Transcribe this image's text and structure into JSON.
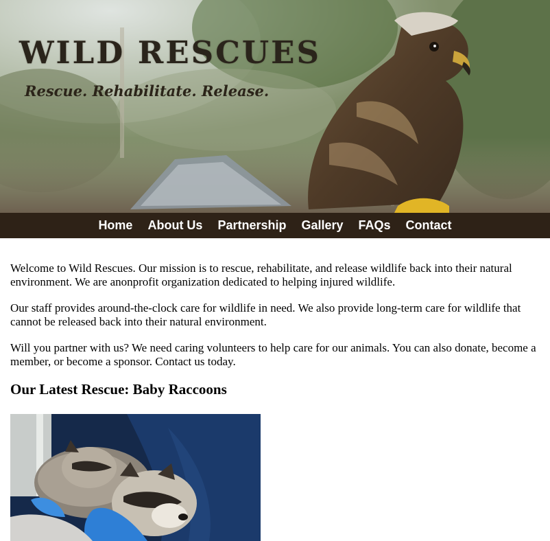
{
  "site": {
    "title": "WILD RESCUES",
    "tagline": "Rescue. Rehabilitate. Release."
  },
  "nav": {
    "items": [
      {
        "label": "Home"
      },
      {
        "label": "About Us"
      },
      {
        "label": "Partnership"
      },
      {
        "label": "Gallery"
      },
      {
        "label": "FAQs"
      },
      {
        "label": "Contact"
      }
    ]
  },
  "main": {
    "paragraphs": [
      "Welcome to Wild Rescues. Our mission is to rescue, rehabilitate, and release wildlife back into their natural environment. We are anonprofit organization dedicated to helping injured wildlife.",
      "Our staff provides around-the-clock care for wildlife in need. We also provide long-term care for wildlife that cannot be released back into their natural environment.",
      "Will you partner with us? We need caring volunteers to help care for our animals. You can also donate, become a member, or become a sponsor. Contact us today."
    ],
    "latest_heading": "Our Latest Rescue: Baby Raccoons"
  },
  "colors": {
    "nav_background": "#2e2217",
    "nav_text": "#ffffff",
    "title_text": "#2a241b"
  }
}
